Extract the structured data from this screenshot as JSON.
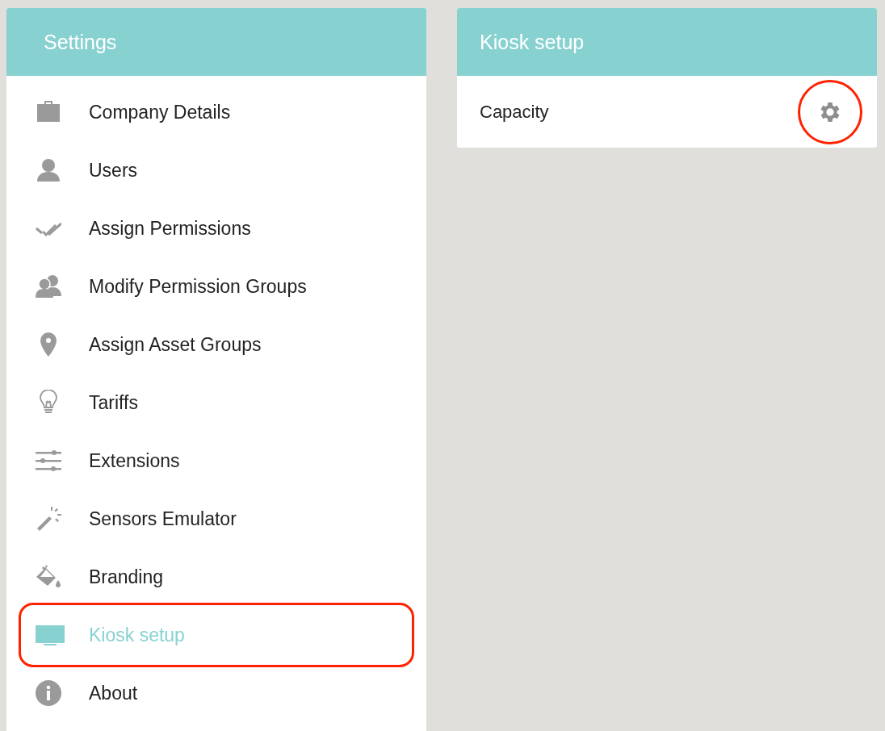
{
  "settings": {
    "title": "Settings",
    "items": [
      {
        "label": "Company Details",
        "kind": "briefcase",
        "selected": false,
        "highlighted": false
      },
      {
        "label": "Users",
        "kind": "user",
        "selected": false,
        "highlighted": false
      },
      {
        "label": "Assign Permissions",
        "kind": "checks",
        "selected": false,
        "highlighted": false
      },
      {
        "label": "Modify Permission Groups",
        "kind": "users",
        "selected": false,
        "highlighted": false
      },
      {
        "label": "Assign Asset Groups",
        "kind": "pin",
        "selected": false,
        "highlighted": false
      },
      {
        "label": "Tariffs",
        "kind": "bulb",
        "selected": false,
        "highlighted": false
      },
      {
        "label": "Extensions",
        "kind": "sliders",
        "selected": false,
        "highlighted": false
      },
      {
        "label": "Sensors Emulator",
        "kind": "wand",
        "selected": false,
        "highlighted": false
      },
      {
        "label": "Branding",
        "kind": "bucket",
        "selected": false,
        "highlighted": false
      },
      {
        "label": "Kiosk setup",
        "kind": "monitor",
        "selected": true,
        "highlighted": true
      },
      {
        "label": "About",
        "kind": "info",
        "selected": false,
        "highlighted": false
      }
    ]
  },
  "detail": {
    "title": "Kiosk setup",
    "rows": [
      {
        "label": "Capacity",
        "highlighted": true
      }
    ]
  }
}
